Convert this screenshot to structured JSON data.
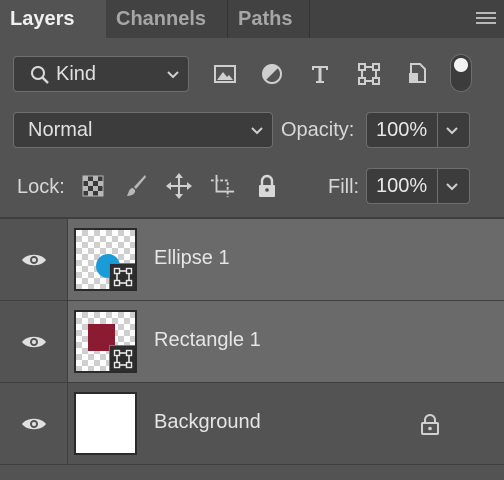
{
  "tabs": [
    {
      "label": "Layers",
      "active": true
    },
    {
      "label": "Channels",
      "active": false
    },
    {
      "label": "Paths",
      "active": false
    }
  ],
  "filter": {
    "kind_label": "Kind",
    "toggle_state": "off"
  },
  "blend": {
    "mode": "Normal",
    "opacity_label": "Opacity:",
    "opacity_value": "100%"
  },
  "lock": {
    "label": "Lock:",
    "fill_label": "Fill:",
    "fill_value": "100%"
  },
  "layers": [
    {
      "name": "Ellipse 1",
      "visible": true,
      "type": "shape",
      "shape": "ellipse",
      "color": "#1b9bd8",
      "selected": true
    },
    {
      "name": "Rectangle 1",
      "visible": true,
      "type": "shape",
      "shape": "rectangle",
      "color": "#8b1a33",
      "selected": true
    },
    {
      "name": "Background",
      "visible": true,
      "type": "pixel",
      "color": "#ffffff",
      "locked": true,
      "selected": false
    }
  ],
  "colors": {
    "panel": "#535353",
    "tabbar": "#424242",
    "selected_layer": "#6a6a6a",
    "field": "#3c3c3c"
  }
}
